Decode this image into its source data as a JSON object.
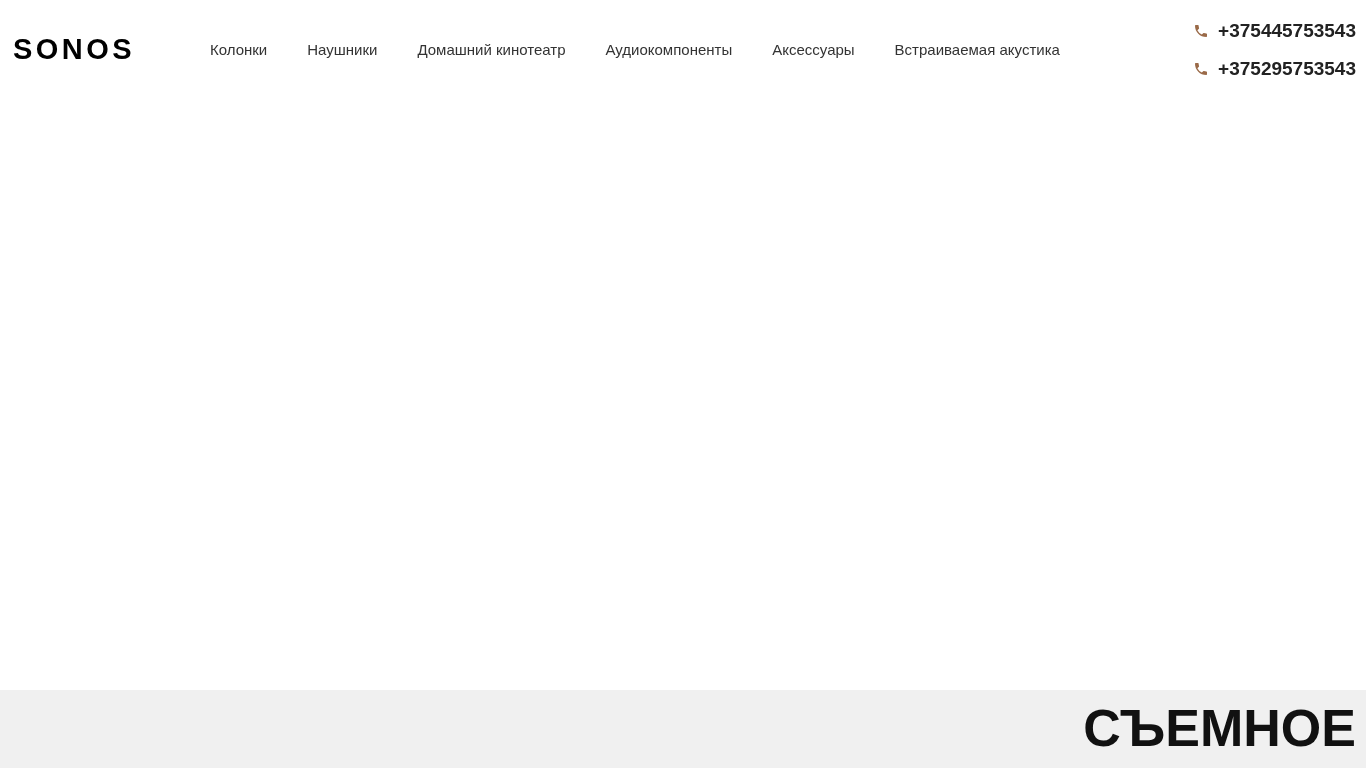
{
  "logo": "SONOS",
  "nav": [
    {
      "label": "Колонки"
    },
    {
      "label": "Наушники"
    },
    {
      "label": "Домашний кинотеатр"
    },
    {
      "label": "Аудиокомпоненты"
    },
    {
      "label": "Аксессуары"
    },
    {
      "label": "Встраиваемая акустика"
    }
  ],
  "phones": [
    "+375445753543",
    "+375295753543"
  ],
  "section": {
    "heading": "СЪЕМНОЕ"
  }
}
